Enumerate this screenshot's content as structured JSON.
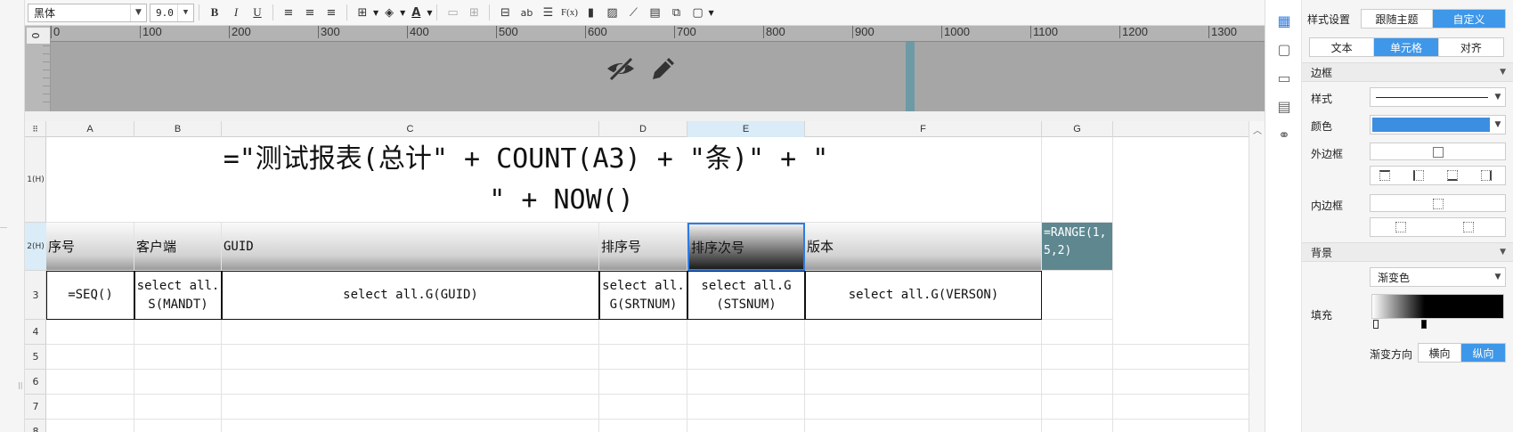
{
  "toolbar": {
    "font_family": "黑体",
    "font_size": "9.0",
    "bold": "B",
    "italic": "I",
    "underline": "U",
    "text_color_glyph": "A",
    "fx": "F(x)",
    "ab": "ab"
  },
  "ruler": {
    "ticks": [
      "0",
      "100",
      "200",
      "300",
      "400",
      "500",
      "600",
      "700",
      "800",
      "900",
      "1000",
      "1100",
      "1200",
      "1300"
    ],
    "v_zero": "0"
  },
  "columns": [
    "A",
    "B",
    "C",
    "D",
    "E",
    "F",
    "G"
  ],
  "rows": {
    "r1": "1(H)",
    "r2": "2(H)",
    "others": [
      "3",
      "4",
      "5",
      "6",
      "7",
      "8"
    ]
  },
  "cells": {
    "title_formula_line1": "=\"测试报表(总计\" + COUNT(A3) + \"条)\" + \"",
    "title_formula_line2": "\" + NOW()",
    "header": {
      "a": "序号",
      "b": "客户端",
      "c": "GUID",
      "d": "排序号",
      "e": "排序次号",
      "f": "版本",
      "g": "=RANGE(1,5,2)"
    },
    "data": {
      "a": "=SEQ()",
      "b": "select all.S(MANDT)",
      "c": "select all.G(GUID)",
      "d": "select all.G(SRTNUM)",
      "e": "select all.G(STSNUM)",
      "f": "select all.G(VERSON)"
    }
  },
  "panel": {
    "style_settings_label": "样式设置",
    "follow_theme": "跟随主题",
    "custom": "自定义",
    "tabs": [
      "文本",
      "单元格",
      "对齐"
    ],
    "border_section": "边框",
    "style_label": "样式",
    "color_label": "颜色",
    "border_color": "#3c8ee0",
    "outer_border_label": "外边框",
    "inner_border_label": "内边框",
    "background_section": "背景",
    "bg_type": "渐变色",
    "fill_label": "填充",
    "gradient_dir_label": "渐变方向",
    "gradient_dirs": [
      "横向",
      "纵向"
    ]
  }
}
